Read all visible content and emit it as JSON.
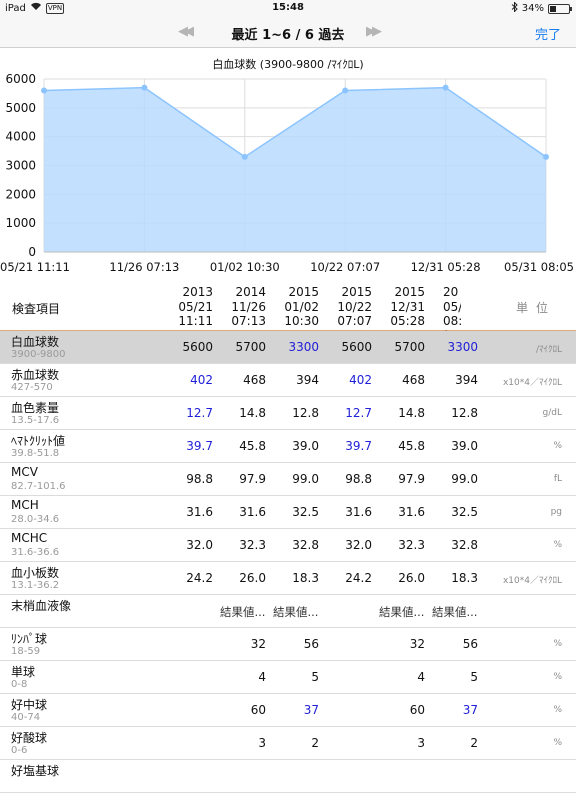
{
  "status_bar": {
    "device": "iPad",
    "vpn": "VPN",
    "time": "15:48",
    "battery": "34%",
    "battery_fraction": 0.34
  },
  "nav": {
    "title": "最近 1~6 / 6 過去",
    "prev_icon": "double-left-arrow-icon",
    "next_icon": "double-right-arrow-icon",
    "done_label": "完了"
  },
  "chart_data": {
    "type": "area",
    "title": "白血球数 (3900-9800 /ﾏｲｸﾛL)",
    "categories": [
      "05/21 11:11",
      "11/26 07:13",
      "01/02 10:30",
      "10/22 07:07",
      "12/31 05:28",
      "05/31 08:05"
    ],
    "values": [
      5600,
      5700,
      3300,
      5600,
      5700,
      3300
    ],
    "ylim": [
      0,
      6000
    ],
    "yticks": [
      0,
      1000,
      2000,
      3000,
      4000,
      5000,
      6000
    ],
    "grid": true,
    "fill_color": "#b8dcff",
    "line_color": "#8cc4ff"
  },
  "table": {
    "header_label": "検査項目",
    "unit_header": "単 位",
    "columns": [
      {
        "year": "2013",
        "date": "05/21",
        "time": "11:11"
      },
      {
        "year": "2014",
        "date": "11/26",
        "time": "07:13"
      },
      {
        "year": "2015",
        "date": "01/02",
        "time": "10:30"
      },
      {
        "year": "2015",
        "date": "10/22",
        "time": "07:07"
      },
      {
        "year": "2015",
        "date": "12/31",
        "time": "05:28"
      },
      {
        "year": "20",
        "date": "05/:",
        "time": "08:("
      }
    ],
    "rows": [
      {
        "name": "白血球数",
        "range": "3900-9800",
        "unit": "/ﾏｲｸﾛL",
        "selected": true,
        "values": [
          "5600",
          "5700",
          "3300",
          "5600",
          "5700",
          "3300"
        ],
        "blue": [
          false,
          false,
          true,
          false,
          false,
          true
        ]
      },
      {
        "name": "赤血球数",
        "range": "427-570",
        "unit": "x10*4／ﾏｲｸﾛL",
        "values": [
          "402",
          "468",
          "394",
          "402",
          "468",
          "394"
        ],
        "blue": [
          true,
          false,
          false,
          true,
          false,
          false
        ]
      },
      {
        "name": "血色素量",
        "range": "13.5-17.6",
        "unit": "g/dL",
        "values": [
          "12.7",
          "14.8",
          "12.8",
          "12.7",
          "14.8",
          "12.8"
        ],
        "blue": [
          true,
          false,
          false,
          true,
          false,
          false
        ]
      },
      {
        "name": "ﾍﾏﾄｸﾘｯﾄ値",
        "range": "39.8-51.8",
        "unit": "%",
        "values": [
          "39.7",
          "45.8",
          "39.0",
          "39.7",
          "45.8",
          "39.0"
        ],
        "blue": [
          true,
          false,
          false,
          true,
          false,
          false
        ]
      },
      {
        "name": "MCV",
        "range": "82.7-101.6",
        "unit": "fL",
        "values": [
          "98.8",
          "97.9",
          "99.0",
          "98.8",
          "97.9",
          "99.0"
        ],
        "blue": [
          false,
          false,
          false,
          false,
          false,
          false
        ]
      },
      {
        "name": "MCH",
        "range": "28.0-34.6",
        "unit": "pg",
        "values": [
          "31.6",
          "31.6",
          "32.5",
          "31.6",
          "31.6",
          "32.5"
        ],
        "blue": [
          false,
          false,
          false,
          false,
          false,
          false
        ]
      },
      {
        "name": "MCHC",
        "range": "31.6-36.6",
        "unit": "%",
        "values": [
          "32.0",
          "32.3",
          "32.8",
          "32.0",
          "32.3",
          "32.8"
        ],
        "blue": [
          false,
          false,
          false,
          false,
          false,
          false
        ]
      },
      {
        "name": "血小板数",
        "range": "13.1-36.2",
        "unit": "x10*4／ﾏｲｸﾛL",
        "values": [
          "24.2",
          "26.0",
          "18.3",
          "24.2",
          "26.0",
          "18.3"
        ],
        "blue": [
          false,
          false,
          false,
          false,
          false,
          false
        ]
      },
      {
        "name": "末梢血液像",
        "range": "",
        "unit": "",
        "values": [
          "",
          "結果値...",
          "結果値...",
          "",
          "結果値...",
          "結果値..."
        ],
        "blue": [
          false,
          false,
          false,
          false,
          false,
          false
        ]
      },
      {
        "name": "ﾘﾝﾊﾟ球",
        "range": "18-59",
        "unit": "%",
        "values": [
          "",
          "32",
          "56",
          "",
          "32",
          "56"
        ],
        "blue": [
          false,
          false,
          false,
          false,
          false,
          false
        ]
      },
      {
        "name": "単球",
        "range": "0-8",
        "unit": "%",
        "values": [
          "",
          "4",
          "5",
          "",
          "4",
          "5"
        ],
        "blue": [
          false,
          false,
          false,
          false,
          false,
          false
        ]
      },
      {
        "name": "好中球",
        "range": "40-74",
        "unit": "%",
        "values": [
          "",
          "60",
          "37",
          "",
          "60",
          "37"
        ],
        "blue": [
          false,
          false,
          true,
          false,
          false,
          true
        ]
      },
      {
        "name": "好酸球",
        "range": "0-6",
        "unit": "%",
        "values": [
          "",
          "3",
          "2",
          "",
          "3",
          "2"
        ],
        "blue": [
          false,
          false,
          false,
          false,
          false,
          false
        ]
      },
      {
        "name": "好塩基球",
        "range": "",
        "unit": "",
        "values": [
          "",
          "",
          "",
          "",
          "",
          ""
        ],
        "blue": [
          false,
          false,
          false,
          false,
          false,
          false
        ]
      }
    ]
  }
}
